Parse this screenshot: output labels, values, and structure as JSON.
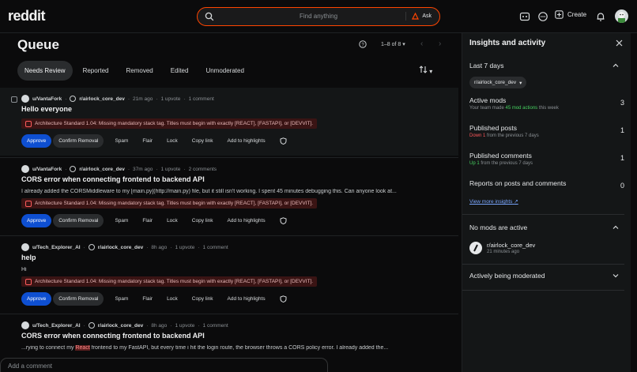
{
  "header": {
    "logo": "reddit",
    "search_placeholder": "Find anything",
    "ask_label": "Ask",
    "create_label": "Create",
    "icons": [
      "mod-queue-icon",
      "chat-icon",
      "plus-icon",
      "bell-icon"
    ]
  },
  "queue": {
    "title": "Queue",
    "pagination": "1–8 of 8",
    "tabs": [
      "Needs Review",
      "Reported",
      "Removed",
      "Edited",
      "Unmoderated"
    ],
    "active_tab": "Needs Review"
  },
  "posts": [
    {
      "user": "u/VantaFork",
      "subreddit": "r/airlock_core_dev",
      "time": "21m ago",
      "upvotes": "1 upvote",
      "comments": "1 comment",
      "title": "Hello everyone",
      "body": "",
      "rule": "Architecture Standard 1.04: Missing mandatory stack tag. Titles must begin with exactly [REACT], [FASTAPI], or [DEVVIT]."
    },
    {
      "user": "u/VantaFork",
      "subreddit": "r/airlock_core_dev",
      "time": "37m ago",
      "upvotes": "1 upvote",
      "comments": "2 comments",
      "title": "CORS error when connecting frontend to backend API",
      "body": "I already added the CORSMiddleware to my [main.py](http://main.py) file, but it still isn't working. I spent 45 minutes debugging this. Can anyone look at...",
      "rule": "Architecture Standard 1.04: Missing mandatory stack tag. Titles must begin with exactly [REACT], [FASTAPI], or [DEVVIT]."
    },
    {
      "user": "u/Tech_Explorer_AI",
      "subreddit": "r/airlock_core_dev",
      "time": "8h ago",
      "upvotes": "1 upvote",
      "comments": "1 comment",
      "title": "help",
      "body": "Hi",
      "rule": "Architecture Standard 1.04: Missing mandatory stack tag. Titles must begin with exactly [REACT], [FASTAPI], or [DEVVIT]."
    },
    {
      "user": "u/Tech_Explorer_AI",
      "subreddit": "r/airlock_core_dev",
      "time": "8h ago",
      "upvotes": "1 upvote",
      "comments": "1 comment",
      "title": "CORS error when connecting frontend to backend API",
      "body_pre": "...rying to connect my ",
      "body_hl": "React",
      "body_post": " frontend to my FastAPI, but every time i hit the login route, the browser throws a CORS policy error. I already added the..."
    }
  ],
  "actions": {
    "approve": "Approve",
    "confirm_removal": "Confirm Removal",
    "spam": "Spam",
    "flair": "Flair",
    "lock": "Lock",
    "copy_link": "Copy link",
    "highlights": "Add to highlights"
  },
  "comment_box": {
    "placeholder": "Add a comment"
  },
  "insights": {
    "title": "Insights and activity",
    "period": "Last 7 days",
    "subreddit_pill": "r/airlock_core_dev",
    "active_mods": {
      "label": "Active mods",
      "sub_pre": "Your team made ",
      "sub_hl": "45 mod actions",
      "sub_post": " this week",
      "value": "3"
    },
    "published_posts": {
      "label": "Published posts",
      "sub_hl": "Down 1",
      "sub_post": " from the previous 7 days",
      "value": "1"
    },
    "published_comments": {
      "label": "Published comments",
      "sub_hl": "Up 1",
      "sub_post": " from the previous 7 days",
      "value": "1"
    },
    "reports": {
      "label": "Reports on posts and comments",
      "value": "0"
    },
    "more_link": "View more insights",
    "no_mods_title": "No mods are active",
    "mod_sub": "r/airlock_core_dev",
    "mod_time": "21 minutes ago",
    "actively_title": "Actively being moderated"
  },
  "colors": {
    "brand": "#ff4500",
    "approve": "#0e4fd1",
    "rule_bg": "#3a1414",
    "up": "#46d160",
    "down": "#ff585b"
  }
}
